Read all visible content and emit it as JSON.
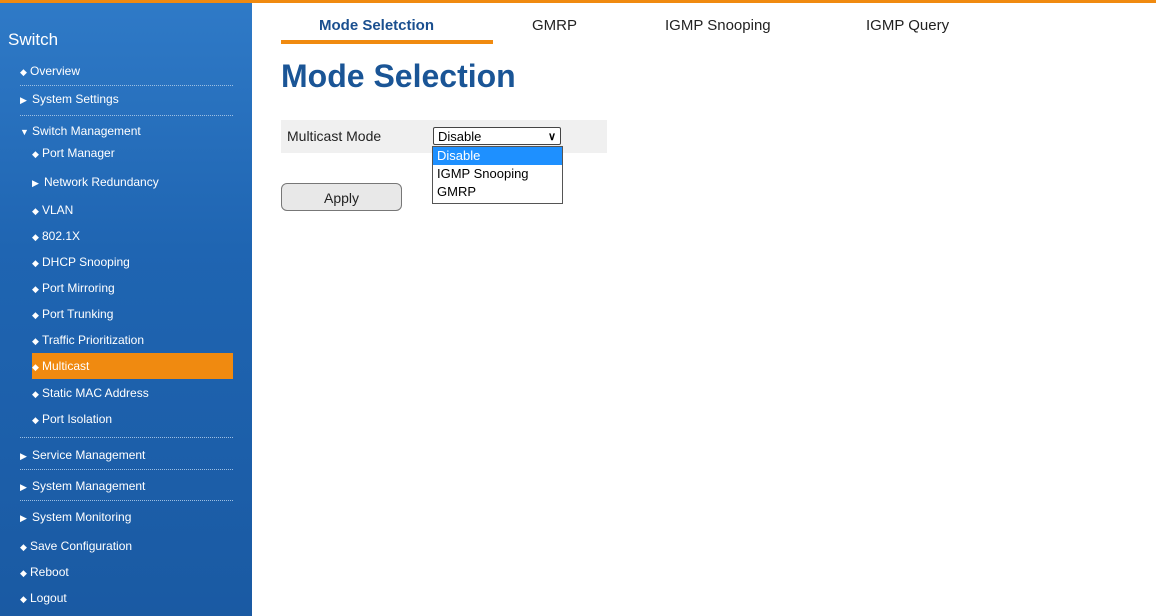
{
  "colors": {
    "accent": "#f08a10",
    "sidebar": "#1f65b2",
    "title": "#1a5596",
    "selected": "#1e90ff"
  },
  "sidebar": {
    "title": "Switch",
    "items": [
      {
        "label": "Overview",
        "icon": "bullet"
      },
      {
        "label": "System Settings",
        "icon": "arrow-right"
      },
      {
        "label": "Switch Management",
        "icon": "arrow-down"
      },
      {
        "label": "Port Manager",
        "icon": "bullet"
      },
      {
        "label": "Network Redundancy",
        "icon": "arrow-right"
      },
      {
        "label": "VLAN",
        "icon": "bullet"
      },
      {
        "label": "802.1X",
        "icon": "bullet"
      },
      {
        "label": "DHCP Snooping",
        "icon": "bullet"
      },
      {
        "label": "Port Mirroring",
        "icon": "bullet"
      },
      {
        "label": "Port Trunking",
        "icon": "bullet"
      },
      {
        "label": "Traffic Prioritization",
        "icon": "bullet"
      },
      {
        "label": "Multicast",
        "icon": "bullet",
        "active": true
      },
      {
        "label": "Static MAC Address",
        "icon": "bullet"
      },
      {
        "label": "Port Isolation",
        "icon": "bullet"
      },
      {
        "label": "Service Management",
        "icon": "arrow-right"
      },
      {
        "label": "System Management",
        "icon": "arrow-right"
      },
      {
        "label": "System Monitoring",
        "icon": "arrow-right"
      },
      {
        "label": "Save Configuration",
        "icon": "bullet"
      },
      {
        "label": "Reboot",
        "icon": "bullet"
      },
      {
        "label": "Logout",
        "icon": "bullet"
      }
    ]
  },
  "tabs": [
    {
      "label": "Mode Seletction",
      "active": true
    },
    {
      "label": "GMRP"
    },
    {
      "label": "IGMP Snooping"
    },
    {
      "label": "IGMP Query"
    }
  ],
  "main": {
    "title": "Mode Selection",
    "multicast_label": "Multicast Mode",
    "select_value": "Disable",
    "options": [
      "Disable",
      "IGMP Snooping",
      "GMRP"
    ],
    "apply_label": "Apply"
  }
}
